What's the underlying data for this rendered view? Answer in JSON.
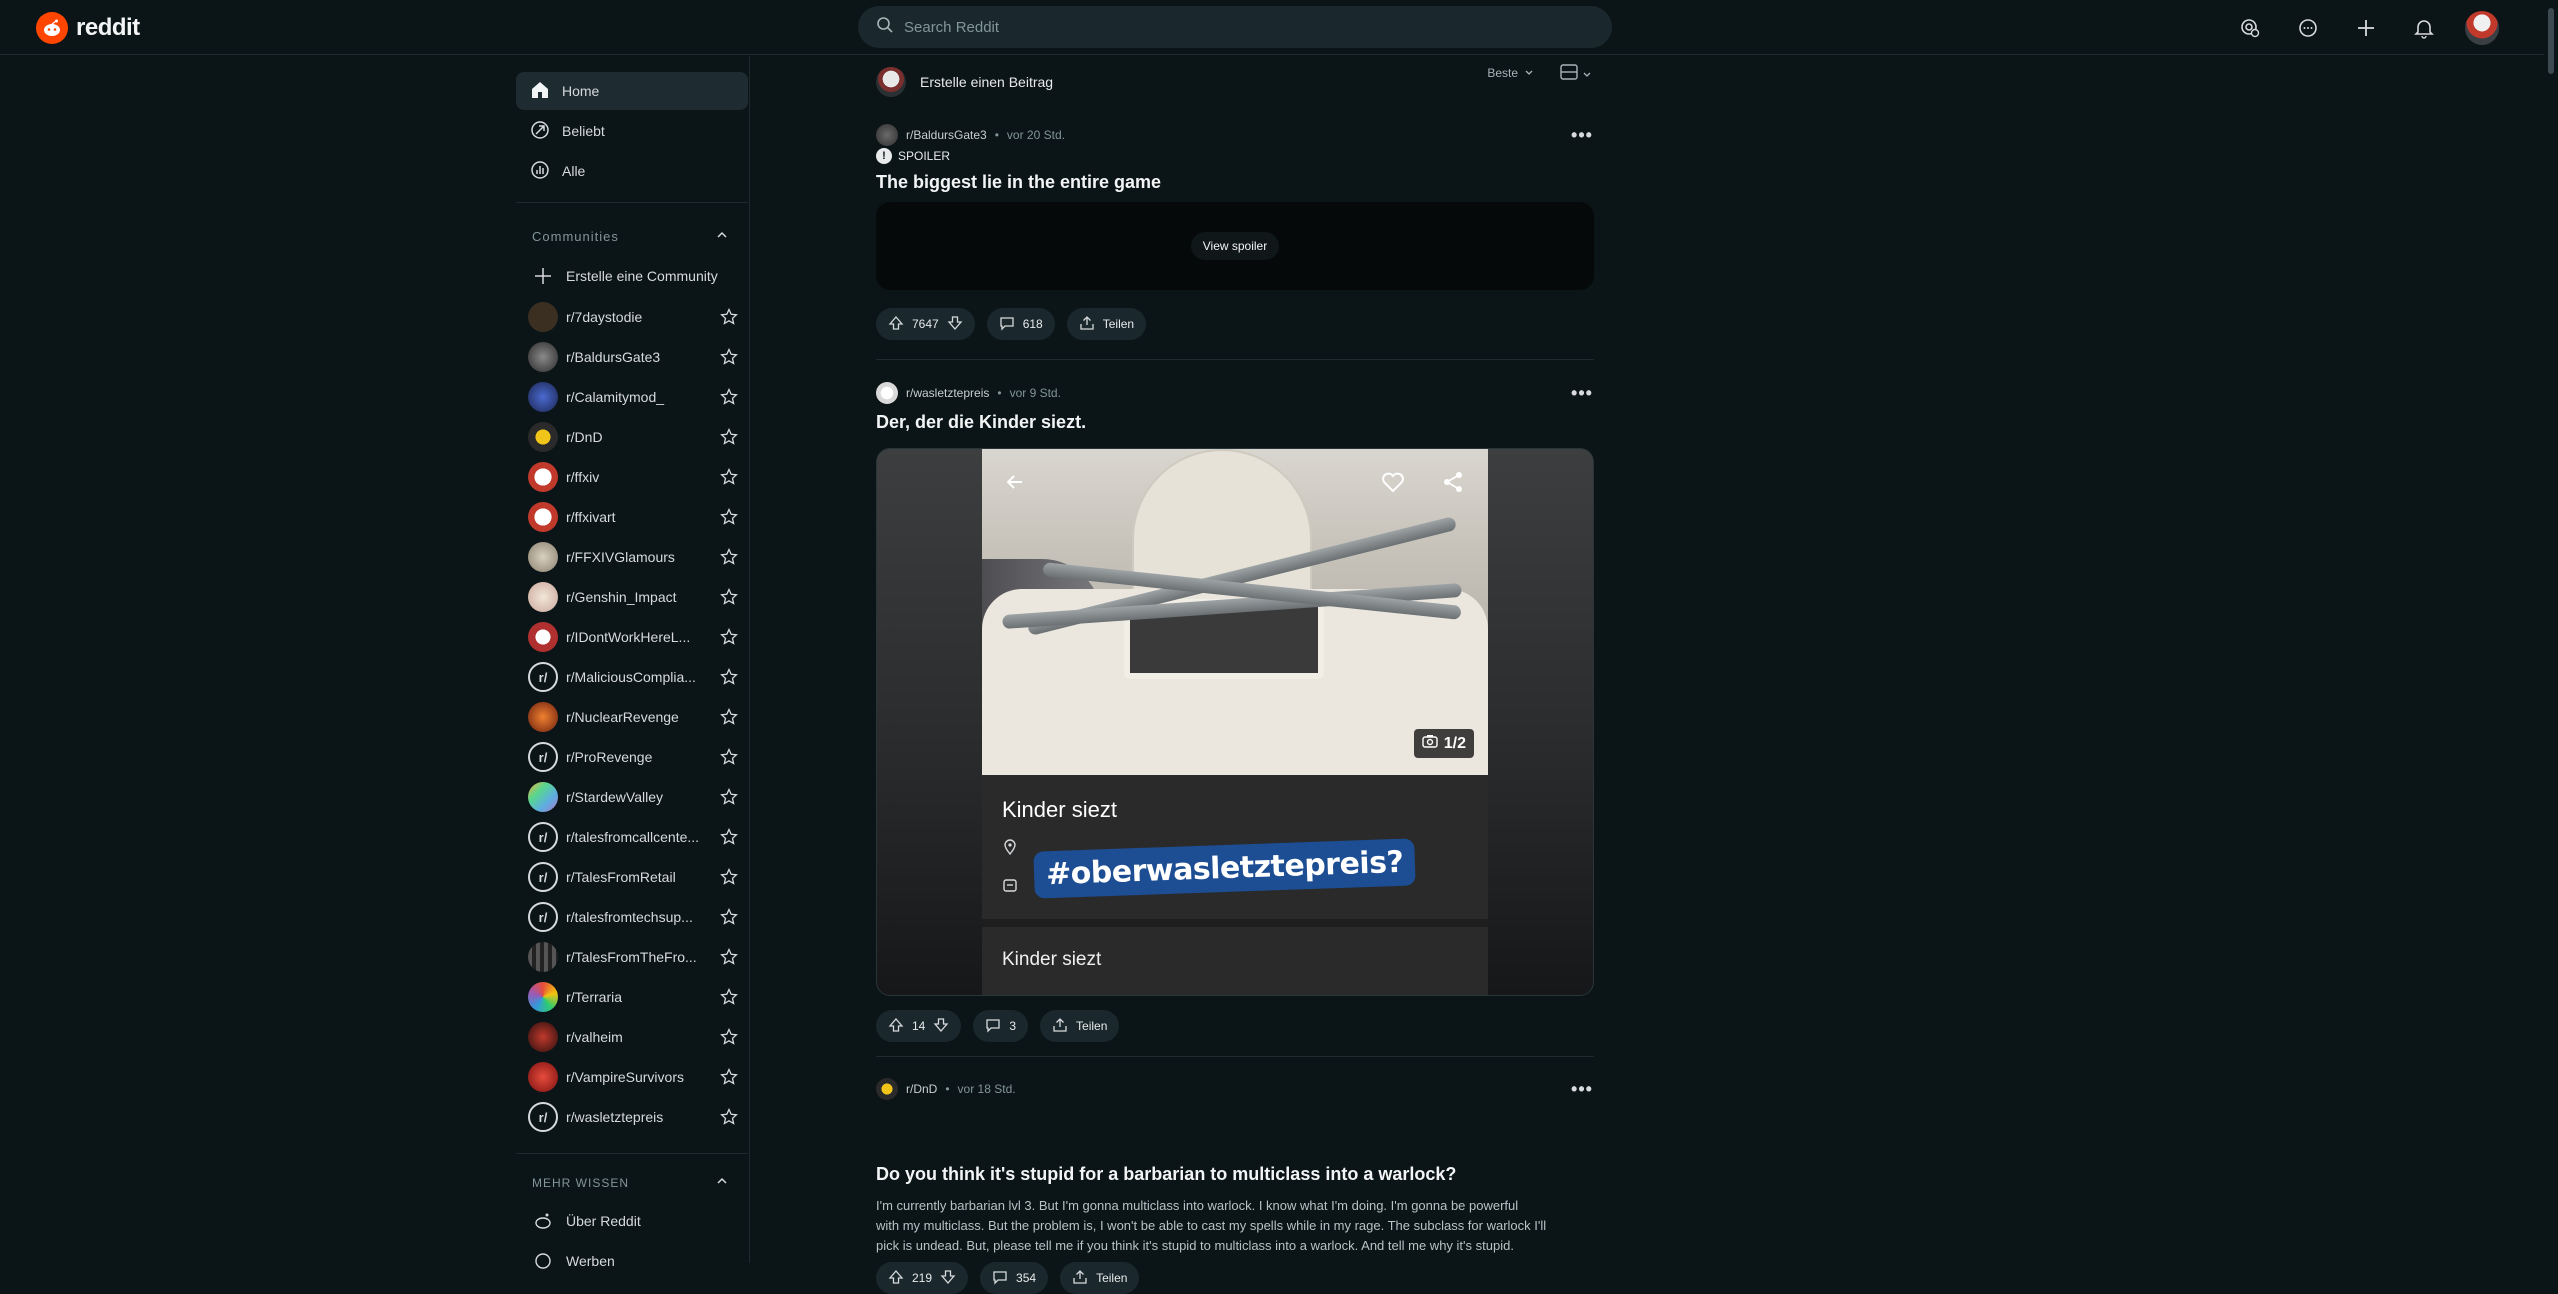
{
  "header": {
    "logo_text": "reddit",
    "search_placeholder": "Search Reddit",
    "icons": [
      "advertise-icon",
      "chat-icon",
      "create-plus-icon",
      "notifications-bell-icon",
      "user-avatar"
    ]
  },
  "sidebar": {
    "nav": [
      {
        "label": "Home",
        "icon": "home-icon",
        "active": true
      },
      {
        "label": "Beliebt",
        "icon": "popular-arrow-icon"
      },
      {
        "label": "Alle",
        "icon": "all-chart-icon"
      }
    ],
    "communities_label": "Communities",
    "create_community": "Erstelle eine Community",
    "communities": [
      {
        "name": "r/7daystodie"
      },
      {
        "name": "r/BaldursGate3"
      },
      {
        "name": "r/Calamitymod_"
      },
      {
        "name": "r/DnD"
      },
      {
        "name": "r/ffxiv"
      },
      {
        "name": "r/ffxivart"
      },
      {
        "name": "r/FFXIVGlamours"
      },
      {
        "name": "r/Genshin_Impact"
      },
      {
        "name": "r/IDontWorkHereL..."
      },
      {
        "name": "r/MaliciousComplia..."
      },
      {
        "name": "r/NuclearRevenge"
      },
      {
        "name": "r/ProRevenge"
      },
      {
        "name": "r/StardewValley"
      },
      {
        "name": "r/talesfromcallcente..."
      },
      {
        "name": "r/TalesFromRetail"
      },
      {
        "name": "r/talesfromtechsup..."
      },
      {
        "name": "r/TalesFromTheFro..."
      },
      {
        "name": "r/Terraria"
      },
      {
        "name": "r/valheim"
      },
      {
        "name": "r/VampireSurvivors"
      },
      {
        "name": "r/wasletztepreis"
      }
    ],
    "more_label": "MEHR WISSEN",
    "more_items": [
      {
        "label": "Über Reddit"
      },
      {
        "label": "Werben"
      }
    ]
  },
  "feed": {
    "create_post": "Erstelle einen Beitrag",
    "sort_label": "Beste",
    "posts": [
      {
        "subreddit": "r/BaldursGate3",
        "time": "vor 20 Std.",
        "spoiler": "SPOILER",
        "title": "The biggest lie in the entire game",
        "spoiler_button": "View spoiler",
        "votes": "7647",
        "comments": "618",
        "share": "Teilen"
      },
      {
        "subreddit": "r/wasletztepreis",
        "time": "vor 9 Std.",
        "title": "Der, der die Kinder siezt.",
        "counter": "1/2",
        "caption_title": "Kinder siezt",
        "hashtag": "#oberwasletztepreis?",
        "caption_bottom": "Kinder siezt",
        "votes": "14",
        "comments": "3",
        "share": "Teilen"
      },
      {
        "subreddit": "r/DnD",
        "time": "vor 18 Std.",
        "title": "Do you think it's stupid for a barbarian to multiclass into a warlock?",
        "body_lines": [
          "I'm currently barbarian lvl 3. But I'm gonna multiclass into warlock. I know what I'm doing. I'm gonna be powerful",
          "with my multiclass. But the problem is, I won't be able to cast my spells while in my rage. The subclass for warlock I'll",
          "pick is undead. But, please tell me if you think it's stupid to multiclass into a warlock. And tell me why it's stupid."
        ],
        "votes": "219",
        "comments": "354",
        "share": "Teilen"
      }
    ]
  }
}
